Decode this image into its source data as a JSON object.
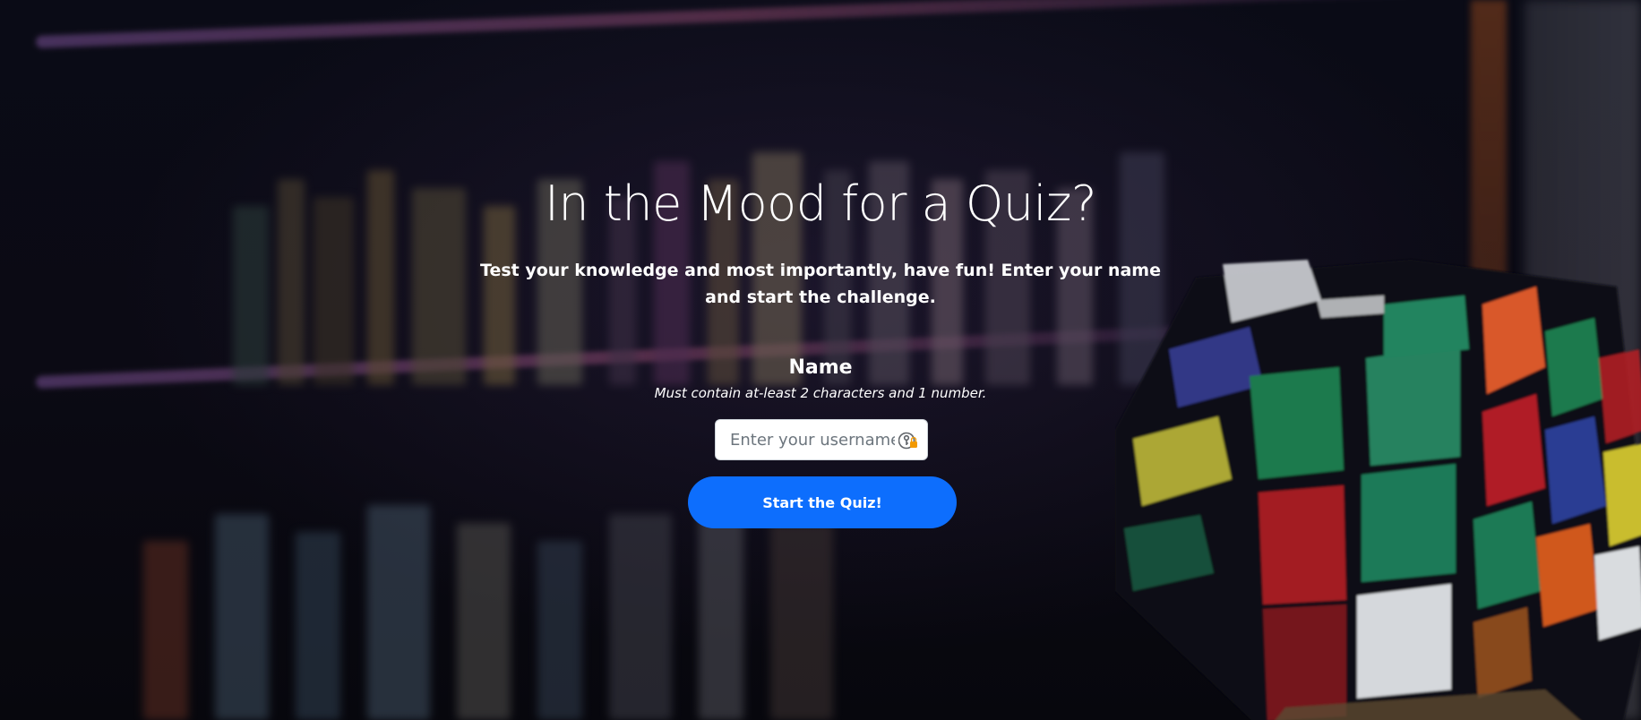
{
  "hero": {
    "title": "In the Mood for a Quiz?",
    "subtitle": "Test your knowledge and most importantly, have fun! Enter your name and start the challenge."
  },
  "form": {
    "name_label": "Name",
    "hint": "Must contain at-least 2 characters and 1 number.",
    "username_placeholder": "Enter your username",
    "username_value": "",
    "password_manager_icon": "key-lock-icon",
    "start_button_label": "Start the Quiz!"
  },
  "colors": {
    "primary_button": "#0d6efd",
    "text": "#ffffff",
    "background": "#05060d"
  }
}
